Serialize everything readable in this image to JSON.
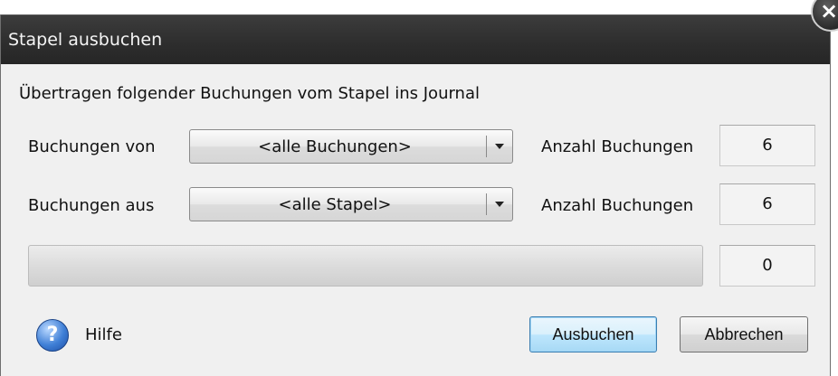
{
  "window": {
    "title": "Stapel ausbuchen"
  },
  "description": "Übertragen folgender Buchungen vom Stapel ins Journal",
  "row1": {
    "label": "Buchungen von",
    "combo_value": "<alle Buchungen>",
    "count_label": "Anzahl Buchungen",
    "count_value": "6"
  },
  "row2": {
    "label": "Buchungen aus",
    "combo_value": "<alle Stapel>",
    "count_label": "Anzahl Buchungen",
    "count_value": "6"
  },
  "progress": {
    "fraction": 0,
    "value_text": "0"
  },
  "help": {
    "label": "Hilfe",
    "icon": "?"
  },
  "buttons": {
    "primary": "Ausbuchen",
    "cancel": "Abbrechen"
  },
  "icons": {
    "close": "×"
  }
}
